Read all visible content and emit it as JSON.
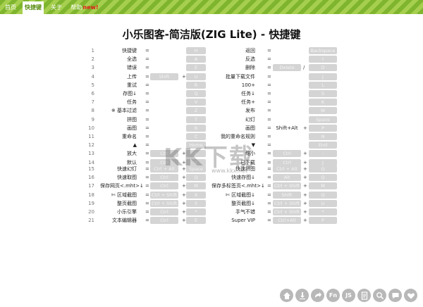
{
  "nav": {
    "tabs": [
      {
        "label": "首页"
      },
      {
        "label": "快捷键"
      },
      {
        "label": "关于"
      },
      {
        "label": "帮助",
        "badge": "new!"
      }
    ],
    "active_tab": 1
  },
  "page": {
    "title": "小乐图客-简洁版(ZIG Lite) - 快捷键"
  },
  "shortcuts": [
    {
      "n": "1",
      "left": {
        "name": "快捷键",
        "mod": "",
        "key": "H"
      },
      "right": {
        "name": "返回",
        "mod": "",
        "key": "Backspace"
      }
    },
    {
      "n": "2",
      "left": {
        "name": "全选",
        "mod": "",
        "key": "A"
      },
      "right": {
        "name": "反选",
        "mod": "",
        "key": "I"
      }
    },
    {
      "n": "3",
      "left": {
        "name": "错误",
        "mod": "",
        "key": "E"
      },
      "right": {
        "name": "删除",
        "mod": "Delete",
        "sep": "/",
        "key": "D"
      }
    },
    {
      "n": "4",
      "left": {
        "name": "上传",
        "mod": "Shift",
        "key": "U"
      },
      "right": {
        "name": "批量下载文件",
        "mod": "",
        "key": "J"
      }
    },
    {
      "n": "5",
      "left": {
        "name": "重试",
        "mod": "",
        "key": "R"
      },
      "right": {
        "name": "100+",
        "mod": "",
        "key": "L"
      }
    },
    {
      "n": "6",
      "left": {
        "name": "存图↓",
        "mod": "",
        "key": "Q"
      },
      "right": {
        "name": "任务↓",
        "mod": "",
        "key": "S"
      }
    },
    {
      "n": "7",
      "left": {
        "name": "任务",
        "mod": "",
        "key": "V"
      },
      "right": {
        "name": "任务+",
        "mod": "",
        "key": "K"
      }
    },
    {
      "n": "8",
      "left": {
        "name": "※ 基本过滤",
        "mod": "",
        "key": "Z"
      },
      "right": {
        "name": "发布",
        "mod": "",
        "key": "W"
      }
    },
    {
      "n": "9",
      "left": {
        "name": "拼图",
        "mod": "",
        "key": "T"
      },
      "right": {
        "name": "幻灯",
        "mod": "",
        "key": "Space"
      }
    },
    {
      "n": "10",
      "left": {
        "name": "画图",
        "mod": "",
        "key": "B"
      },
      "right": {
        "name": "画图",
        "mod": "Shift+Alt",
        "mod_plain": true,
        "key": "P"
      }
    },
    {
      "n": "11",
      "left": {
        "name": "重命名",
        "mod": "",
        "key": "C"
      },
      "right": {
        "name": "我的重命名规则",
        "mod": "",
        "key": "N"
      }
    },
    {
      "n": "12",
      "left": {
        "name": "▲",
        "mod": "",
        "key": "Home"
      },
      "right": {
        "name": "▼",
        "mod": "",
        "key": "End"
      }
    },
    {
      "n": "13",
      "left": {
        "name": "放大",
        "mod": "Ctrl",
        "key": "+"
      },
      "right": {
        "name": "缩小",
        "mod": "Ctrl",
        "key": "-"
      }
    },
    {
      "n": "14",
      "left": {
        "name": "默认",
        "mod": "Ctrl",
        "key": "0"
      },
      "right": {
        "name": "已下载",
        "mod": "Ctrl",
        "key": "J"
      }
    },
    {
      "n": "15",
      "left": {
        "name": "快速幻灯",
        "mod": "Ctrl + Alt",
        "key": "Space"
      },
      "right": {
        "name": "快速拼图",
        "mod": "Ctrl + Alt",
        "key": "Q"
      }
    },
    {
      "n": "16",
      "left": {
        "name": "快速取图",
        "mod": "Ctrl",
        "key": "Q"
      },
      "right": {
        "name": "快速存图↓",
        "mod": "Alt",
        "key": "Q"
      }
    },
    {
      "n": "17",
      "left": {
        "name": "保存网页<.mht>↓",
        "mod": "Ctrl",
        "key": "M"
      },
      "right": {
        "name": "保存多标签页<.mht>↓",
        "mod": "Ctrl + Shift",
        "key": "M"
      }
    },
    {
      "n": "18",
      "left": {
        "name": "✄ 区域截图",
        "mod": "Ctrl + Shift",
        "key": "X"
      },
      "right": {
        "name": "✄ 区域截图↓",
        "mod": "Shift",
        "key": "Q"
      }
    },
    {
      "n": "19",
      "left": {
        "name": "整页截图",
        "mod": "Ctrl + Shift",
        "key": "S"
      },
      "right": {
        "name": "整页截图↓",
        "mod": "Ctrl + Shift",
        "key": "U"
      }
    },
    {
      "n": "20",
      "left": {
        "name": "小乐引擎",
        "mod": "Ctrl",
        "key": "*"
      },
      "right": {
        "name": "手气不错",
        "mod": "Ctrl + Shift",
        "key": "*"
      }
    },
    {
      "n": "21",
      "left": {
        "name": "文本编辑器",
        "mod": "Ctrl",
        "key": "E"
      },
      "right": {
        "name": "Super VIP",
        "mod": "Ctrl+Alt",
        "key": "P"
      }
    }
  ],
  "watermark": {
    "text": "KK下载",
    "url": "www.kkx.net"
  },
  "toolbar": [
    {
      "icon": "home-icon",
      "glyph": ""
    },
    {
      "icon": "download-icon",
      "glyph": ""
    },
    {
      "icon": "share-icon",
      "glyph": ""
    },
    {
      "icon": "fn-icon",
      "glyph": "Fn"
    },
    {
      "icon": "js-icon",
      "glyph": "JS"
    },
    {
      "icon": "document-icon",
      "glyph": ""
    },
    {
      "icon": "search-icon",
      "glyph": ""
    },
    {
      "icon": "chat-icon",
      "glyph": ""
    },
    {
      "icon": "heart-icon",
      "glyph": ""
    }
  ]
}
